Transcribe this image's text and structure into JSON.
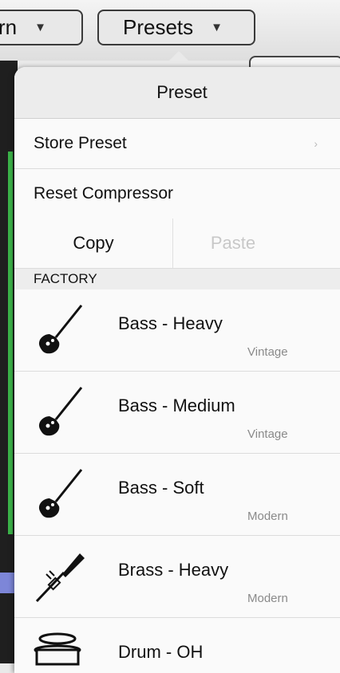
{
  "top": {
    "left_button_label": "rn",
    "presets_button_label": "Presets",
    "caret": "▼"
  },
  "popover": {
    "title": "Preset",
    "store_label": "Store Preset",
    "store_chevron": "›",
    "reset_label": "Reset Compressor",
    "copy_label": "Copy",
    "paste_label": "Paste",
    "section_label": "FACTORY",
    "presets": [
      {
        "name": "Bass -  Heavy",
        "tag": "Vintage",
        "icon": "bass-guitar-icon"
      },
      {
        "name": "Bass - Medium",
        "tag": "Vintage",
        "icon": "bass-guitar-icon"
      },
      {
        "name": "Bass - Soft",
        "tag": "Modern",
        "icon": "bass-guitar-icon"
      },
      {
        "name": "Brass - Heavy",
        "tag": "Modern",
        "icon": "trumpet-icon"
      },
      {
        "name": "Drum - OH",
        "tag": "",
        "icon": "drum-icon"
      }
    ]
  },
  "colors": {
    "accent_green": "#3cb54a",
    "accent_purple": "#7d86d8"
  }
}
